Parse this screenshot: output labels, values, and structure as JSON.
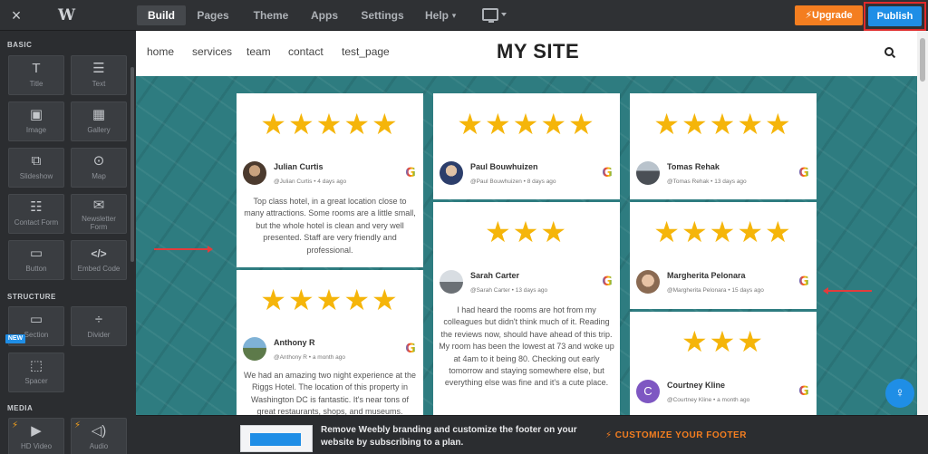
{
  "topbar": {
    "close_icon": "×",
    "logo": "W",
    "tabs": [
      "Build",
      "Pages",
      "Theme",
      "Apps",
      "Settings",
      "Help"
    ],
    "help_caret": "▾",
    "upgrade": "Upgrade",
    "publish": "Publish"
  },
  "sidebar": {
    "basic_label": "BASIC",
    "structure_label": "STRUCTURE",
    "media_label": "MEDIA",
    "new_badge": "NEW",
    "items": {
      "title": {
        "label": "Title",
        "icon": "T"
      },
      "text": {
        "label": "Text",
        "icon": "☰"
      },
      "image": {
        "label": "Image",
        "icon": "▣"
      },
      "gallery": {
        "label": "Gallery",
        "icon": "▦"
      },
      "slideshow": {
        "label": "Slideshow",
        "icon": "⧉"
      },
      "map": {
        "label": "Map",
        "icon": "⊙"
      },
      "contact_form": {
        "label": "Contact Form",
        "icon": "☷"
      },
      "newsletter_form": {
        "label": "Newsletter Form",
        "icon": "✉"
      },
      "button": {
        "label": "Button",
        "icon": "▭"
      },
      "embed_code": {
        "label": "Embed Code",
        "icon": "</>"
      },
      "section": {
        "label": "Section",
        "icon": "▭"
      },
      "divider": {
        "label": "Divider",
        "icon": "÷"
      },
      "spacer": {
        "label": "Spacer",
        "icon": "⬚"
      },
      "hd_video": {
        "label": "HD Video",
        "icon": "▶"
      },
      "audio": {
        "label": "Audio",
        "icon": "◁)"
      }
    }
  },
  "site": {
    "nav": [
      "home",
      "services",
      "team",
      "contact",
      "test_page"
    ],
    "title": "MY SITE"
  },
  "reviews": [
    {
      "name": "Julian Curtis",
      "handle": "@Julian Curtis",
      "ago": "4 days ago",
      "stars": "★★★★★",
      "text": "Top class hotel, in a great location close to many attractions. Some rooms are a little small, but the whole hotel is clean and very well presented. Staff are very friendly and professional."
    },
    {
      "name": "Anthony R",
      "handle": "@Anthony R",
      "ago": "a month ago",
      "stars": "★★★★★",
      "text": "We had an amazing two night experience at the Riggs Hotel. The location of this property in Washington DC is fantastic. It's near tons of great restaurants, shops, and museums."
    },
    {
      "name": "Paul Bouwhuizen",
      "handle": "@Paul Bouwhuizen",
      "ago": "8 days ago",
      "stars": "★★★★★",
      "text": ""
    },
    {
      "name": "Sarah Carter",
      "handle": "@Sarah Carter",
      "ago": "13 days ago",
      "stars": "★★★",
      "text": "I had heard the rooms are hot from my colleagues but didn't think much of it. Reading the reviews now, should have ahead of this trip. My room has been the lowest at 73 and woke up at 4am to it being 80. Checking out early tomorrow and staying somewhere else, but everything else was fine and it's a cute place."
    },
    {
      "name": "Tomas Rehak",
      "handle": "@Tomas Rehak",
      "ago": "13 days ago",
      "stars": "★★★★★",
      "text": ""
    },
    {
      "name": "Margherita Pelonara",
      "handle": "@Margherita Pelonara",
      "ago": "15 days ago",
      "stars": "★★★★★",
      "text": ""
    },
    {
      "name": "Courtney Kline",
      "handle": "@Courtney Kline",
      "ago": "a month ago",
      "stars": "★★★",
      "text": "",
      "initial": "C"
    }
  ],
  "meta_sep": "•",
  "google_glyph": "G",
  "help_icon": "♀",
  "banner": {
    "text": "Remove Weebly branding and customize the footer on your website by subscribing to a plan.",
    "cta": "⚡  CUSTOMIZE YOUR FOOTER"
  },
  "colors": {
    "accent_blue": "#1f8ee6",
    "upgrade_orange": "#f47e20",
    "star": "#f5b50a",
    "highlight_red": "#e02b2b"
  }
}
